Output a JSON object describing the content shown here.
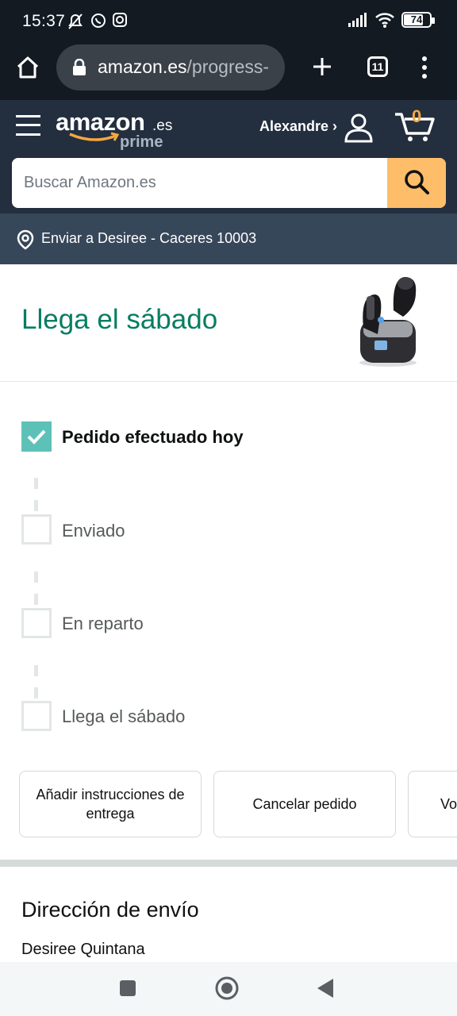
{
  "status_bar": {
    "time": "15:37",
    "battery": "74"
  },
  "browser": {
    "url_host": "amazon.es",
    "url_path": "/progress-",
    "tab_count": "11"
  },
  "header": {
    "logo": "amazon",
    "logo_suffix": ".es",
    "logo_prime": "prime",
    "account_label": "Alexandre ›",
    "cart_count": "0"
  },
  "search": {
    "placeholder": "Buscar Amazon.es"
  },
  "delivery": {
    "text": "Enviar a Desiree - Caceres 10003"
  },
  "order": {
    "arrival_title": "Llega el sábado",
    "steps": [
      {
        "label": "Pedido efectuado hoy",
        "done": true
      },
      {
        "label": "Enviado",
        "done": false
      },
      {
        "label": "En reparto",
        "done": false
      },
      {
        "label": "Llega el sábado",
        "done": false
      }
    ],
    "actions": [
      {
        "label": "Añadir instrucciones de entrega"
      },
      {
        "label": "Cancelar pedido"
      },
      {
        "label": "Vo"
      }
    ]
  },
  "shipping": {
    "title": "Dirección de envío",
    "name": "Desiree Quintana"
  },
  "colors": {
    "header_bg": "#232f3e",
    "deliver_bg": "#37475a",
    "accent_teal": "#067d62",
    "check_teal": "#5ec1b8",
    "search_button": "#febd69",
    "cart_orange": "#f2a742"
  }
}
